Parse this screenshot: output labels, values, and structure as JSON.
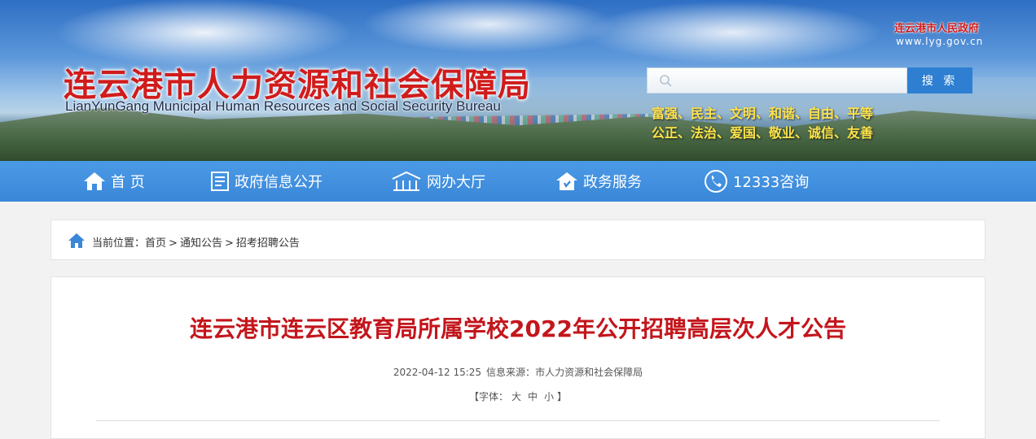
{
  "header": {
    "title": "连云港市人力资源和社会保障局",
    "subtitle": "LianYunGang Municipal Human Resources and Social Security Bureau",
    "gov_name": "连云港市人民政府",
    "gov_url": "www.lyg.gov.cn",
    "slogan_line1": "富强、民主、文明、和谐、自由、平等",
    "slogan_line2": "公正、法治、爱国、敬业、诚信、友善",
    "search": {
      "placeholder": "",
      "button_label": "搜 索"
    }
  },
  "nav": {
    "items": [
      {
        "label": "首 页",
        "icon": "home-icon"
      },
      {
        "label": "政府信息公开",
        "icon": "document-icon"
      },
      {
        "label": "网办大厅",
        "icon": "building-icon"
      },
      {
        "label": "政务服务",
        "icon": "service-house-icon"
      },
      {
        "label": "12333咨询",
        "icon": "phone-icon"
      }
    ]
  },
  "breadcrumb": {
    "prefix": "当前位置：",
    "items": [
      "首页",
      "通知公告",
      "招考招聘公告"
    ],
    "separator": ">"
  },
  "article": {
    "title": "连云港市连云区教育局所属学校2022年公开招聘高层次人才公告",
    "time": "2022-04-12 15:25",
    "source_label": "信息来源：",
    "source": "市人力资源和社会保障局",
    "fontsize_open": "【字体：",
    "fontsize_large": "大",
    "fontsize_medium": "中",
    "fontsize_small": "小",
    "fontsize_close": "】"
  },
  "colors": {
    "title_red": "#d01c1c",
    "nav_blue": "#3a87d8",
    "search_button": "#2e7fd1",
    "slogan_yellow": "#ffe34a",
    "article_title": "#c3161c"
  }
}
